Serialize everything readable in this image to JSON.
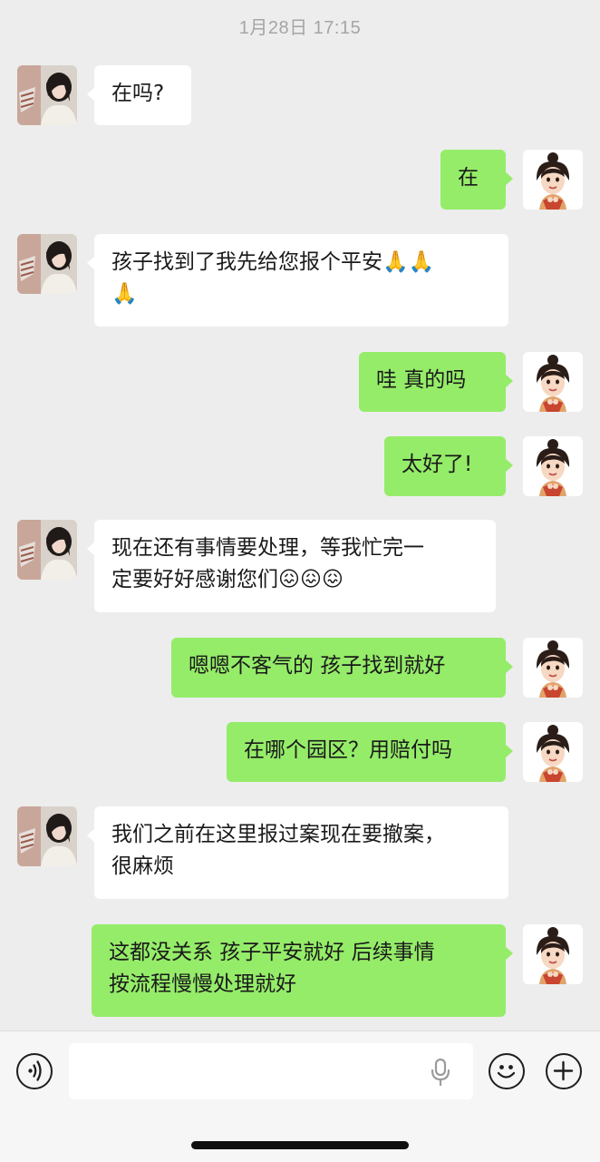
{
  "timestamp": "1月28日 17:15",
  "messages": [
    {
      "side": "left",
      "text": "在吗?"
    },
    {
      "side": "right",
      "text": "在"
    },
    {
      "side": "left",
      "text": "孩子找到了我先给您报个平安🙏🙏\n🙏"
    },
    {
      "side": "right",
      "text": "哇 真的吗"
    },
    {
      "side": "right",
      "text": "太好了!"
    },
    {
      "side": "left",
      "text": "现在还有事情要处理，等我忙完一\n定要好好感谢您们😖😖😖"
    },
    {
      "side": "right",
      "text": "嗯嗯不客气的 孩子找到就好"
    },
    {
      "side": "right",
      "text": "在哪个园区？用赔付吗"
    },
    {
      "side": "left",
      "text": "我们之前在这里报过案现在要撤案，\n很麻烦"
    },
    {
      "side": "right",
      "text": "这都没关系 孩子平安就好 后续事情\n按流程慢慢处理就好"
    }
  ],
  "input_bar": {
    "voice_icon": "voice-icon",
    "mic_icon": "microphone-icon",
    "emoji_icon": "emoji-icon",
    "add_icon": "plus-icon",
    "input_value": ""
  },
  "colors": {
    "background": "#ededed",
    "sent_bubble": "#95ec69",
    "received_bubble": "#ffffff"
  }
}
